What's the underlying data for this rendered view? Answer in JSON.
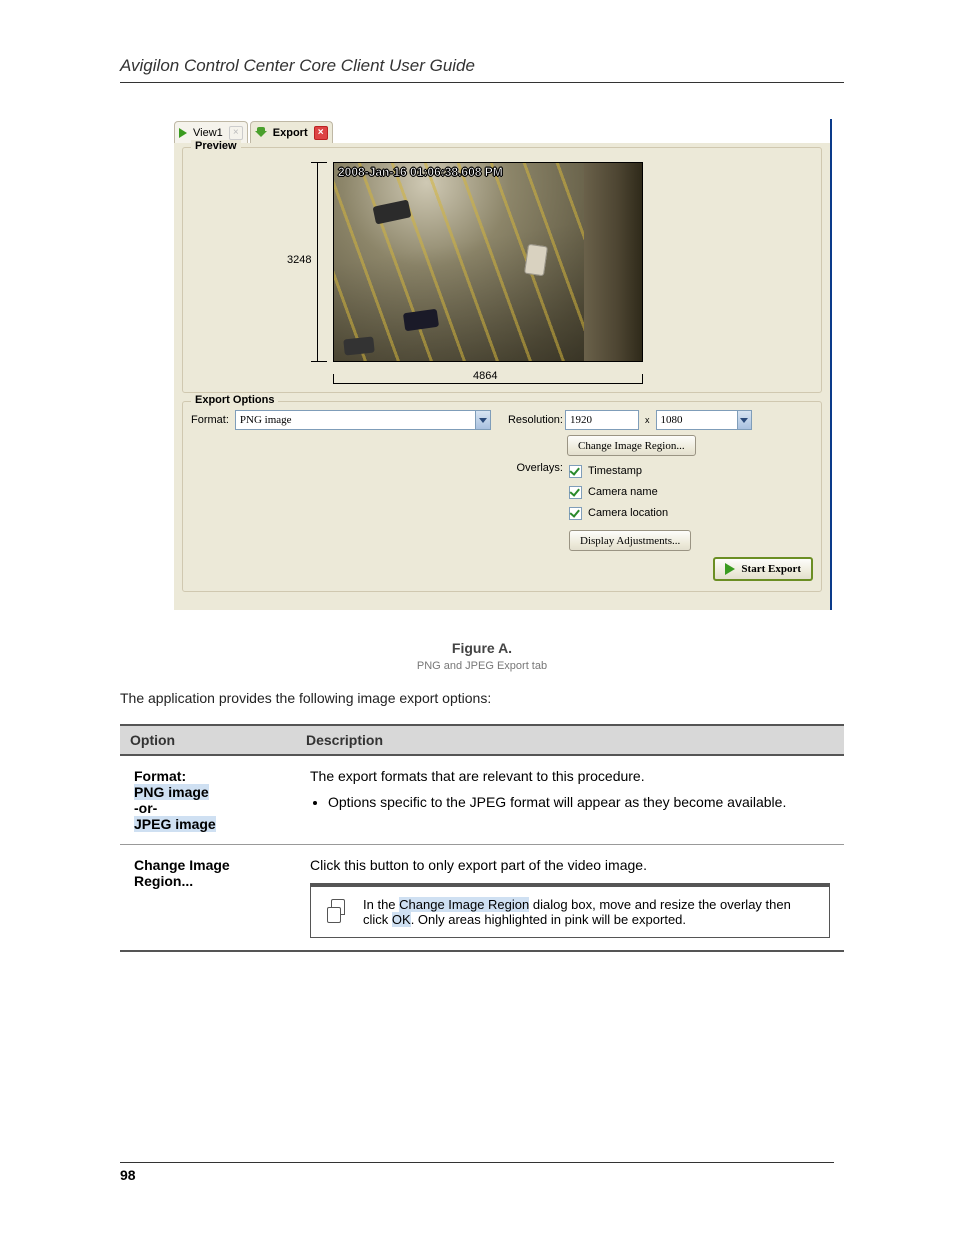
{
  "doc": {
    "header_title": "Avigilon Control Center Core Client User Guide",
    "page_number": "98"
  },
  "tabs": {
    "view1_label": "View1",
    "export_label": "Export"
  },
  "preview": {
    "legend": "Preview",
    "timestamp": "2008-Jan-16 01:06:38.608 PM",
    "dim_height": "3248",
    "dim_width": "4864"
  },
  "export_options": {
    "legend": "Export Options",
    "format_label": "Format:",
    "format_value": "PNG image",
    "resolution_label": "Resolution:",
    "res_w": "1920",
    "res_h": "1080",
    "res_sep": "x",
    "change_region_label": "Change Image Region...",
    "overlays_label": "Overlays:",
    "overlay_timestamp": "Timestamp",
    "overlay_camera_name": "Camera name",
    "overlay_camera_location": "Camera location",
    "display_adjustments_label": "Display Adjustments...",
    "start_export_label": "Start Export"
  },
  "figure": {
    "caption": "Figure A.",
    "subcaption": "PNG and JPEG Export tab"
  },
  "intro": "The application provides the following image export options:",
  "table": {
    "head_option": "Option",
    "head_desc": "Description",
    "row1": {
      "c1a": "Format:",
      "c1b_hi": "PNG image",
      "c1c": "-or-",
      "c1d_hi": "JPEG image",
      "desc": "The export formats that are relevant to this procedure.",
      "bullet": "Options specific to the JPEG format will appear as they become available."
    },
    "row2": {
      "c1": "Change Image Region...",
      "d1": "Click this button to only export part of the video image.",
      "d2a": "In the ",
      "d2b_hi": "Change Image Region",
      "d2c": " dialog box, move and resize the overlay then click ",
      "d2d_hi": "OK",
      "d2e": ". Only areas highlighted in pink will be exported."
    }
  }
}
